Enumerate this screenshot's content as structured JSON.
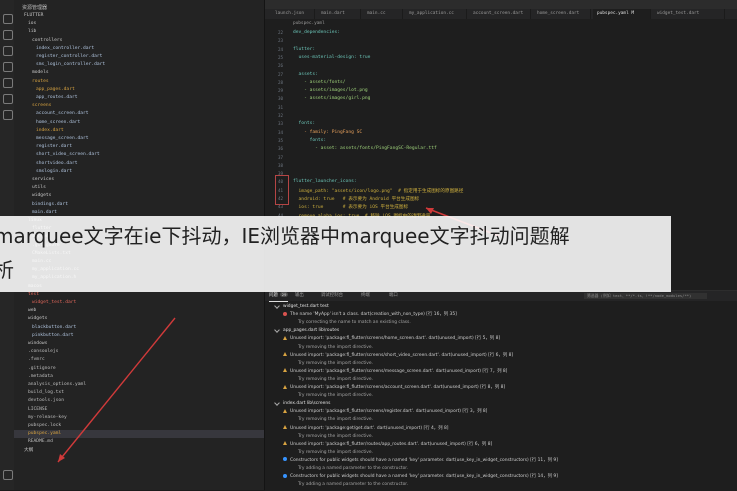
{
  "sidebar": {
    "title": "资源管理器",
    "items": [
      {
        "label": "FLUTTER",
        "kind": "folder"
      },
      {
        "label": "ios",
        "kind": "folder"
      },
      {
        "label": "lib",
        "kind": "folder"
      },
      {
        "label": "controllers",
        "kind": "folder"
      },
      {
        "label": "index_controller.dart",
        "kind": "dart"
      },
      {
        "label": "register_controller.dart",
        "kind": "dart"
      },
      {
        "label": "sms_login_controller.dart",
        "kind": "dart"
      },
      {
        "label": "models",
        "kind": "folder"
      },
      {
        "label": "routes",
        "kind": "warn"
      },
      {
        "label": "app_pages.dart",
        "kind": "warn"
      },
      {
        "label": "app_routes.dart",
        "kind": "dart"
      },
      {
        "label": "screens",
        "kind": "warn"
      },
      {
        "label": "account_screen.dart",
        "kind": "dart"
      },
      {
        "label": "home_screen.dart",
        "kind": "dart"
      },
      {
        "label": "index.dart",
        "kind": "warn"
      },
      {
        "label": "message_screen.dart",
        "kind": "dart"
      },
      {
        "label": "register.dart",
        "kind": "dart"
      },
      {
        "label": "short_video_screen.dart",
        "kind": "dart"
      },
      {
        "label": "shortvideo.dart",
        "kind": "dart"
      },
      {
        "label": "smslogin.dart",
        "kind": "dart"
      },
      {
        "label": "services",
        "kind": "folder"
      },
      {
        "label": "utils",
        "kind": "folder"
      },
      {
        "label": "widgets",
        "kind": "folder"
      },
      {
        "label": "bindings.dart",
        "kind": "dart"
      },
      {
        "label": "main.dart",
        "kind": "dart"
      },
      {
        "label": "linux",
        "kind": "folder"
      },
      {
        "label": "flutter",
        "kind": "folder"
      },
      {
        "label": "screen",
        "kind": "folder"
      },
      {
        "label": ".gitignore",
        "kind": "file"
      },
      {
        "label": "CMakeLists.txt",
        "kind": "file"
      },
      {
        "label": "main.cc",
        "kind": "file"
      },
      {
        "label": "my_application.cc",
        "kind": "file"
      },
      {
        "label": "my_application.h",
        "kind": "file"
      },
      {
        "label": "macos",
        "kind": "folder"
      },
      {
        "label": "test",
        "kind": "err"
      },
      {
        "label": "widget_test.dart",
        "kind": "err"
      },
      {
        "label": "web",
        "kind": "folder"
      },
      {
        "label": "widgets",
        "kind": "folder"
      },
      {
        "label": "blackbutton.dart",
        "kind": "dart"
      },
      {
        "label": "pinkbutton.dart",
        "kind": "dart"
      },
      {
        "label": "windows",
        "kind": "folder"
      },
      {
        "label": ".consoolejs",
        "kind": "file"
      },
      {
        "label": ".fvmrc",
        "kind": "file"
      },
      {
        "label": ".gitignore",
        "kind": "file"
      },
      {
        "label": ".metadata",
        "kind": "file"
      },
      {
        "label": "analysis_options.yaml",
        "kind": "file"
      },
      {
        "label": "build_log.txt",
        "kind": "file"
      },
      {
        "label": "devtools.json",
        "kind": "file"
      },
      {
        "label": "LICENSE",
        "kind": "file"
      },
      {
        "label": "my-release-key",
        "kind": "file"
      },
      {
        "label": "pubspec.lock",
        "kind": "file"
      },
      {
        "label": "pubspec.yaml",
        "kind": "mod"
      },
      {
        "label": "README.md",
        "kind": "file"
      },
      {
        "label": "大纲",
        "kind": "folder"
      }
    ]
  },
  "tabs": [
    {
      "label": "launch.json"
    },
    {
      "label": "main.dart"
    },
    {
      "label": "main.cc"
    },
    {
      "label": "my_application.cc"
    },
    {
      "label": "account_screen.dart"
    },
    {
      "label": "home_screen.dart"
    },
    {
      "label": "pubspec.yaml M"
    },
    {
      "label": "widget_test.dart"
    }
  ],
  "breadcrumb": "pubspec.yaml",
  "code": [
    {
      "n": "22",
      "text": "dev_dependencies:",
      "cls": "c-key"
    },
    {
      "n": "23",
      "text": "",
      "cls": "c-plain"
    },
    {
      "n": "24",
      "text": "flutter:",
      "cls": "c-key"
    },
    {
      "n": "25",
      "text": "  uses-material-design: true",
      "cls": "c-key"
    },
    {
      "n": "26",
      "text": "",
      "cls": "c-plain"
    },
    {
      "n": "27",
      "text": "  assets:",
      "cls": "c-key"
    },
    {
      "n": "28",
      "text": "    - assets/fonts/",
      "cls": "c-str"
    },
    {
      "n": "29",
      "text": "    - assets/images/lot.png",
      "cls": "c-str"
    },
    {
      "n": "30",
      "text": "    - assets/images/girl.png",
      "cls": "c-str"
    },
    {
      "n": "31",
      "text": "",
      "cls": "c-plain"
    },
    {
      "n": "32",
      "text": "",
      "cls": "c-plain"
    },
    {
      "n": "33",
      "text": "  fonts:",
      "cls": "c-key"
    },
    {
      "n": "34",
      "text": "    - family: PingFang SC",
      "cls": "c-val"
    },
    {
      "n": "35",
      "text": "      fonts:",
      "cls": "c-key"
    },
    {
      "n": "36",
      "text": "        - asset: assets/fonts/PingFangSC-Regular.ttf",
      "cls": "c-str"
    },
    {
      "n": "37",
      "text": "",
      "cls": "c-plain"
    },
    {
      "n": "38",
      "text": "",
      "cls": "c-plain"
    },
    {
      "n": "39",
      "text": "",
      "cls": "c-plain"
    },
    {
      "n": "40",
      "text": "flutter_launcher_icons:",
      "cls": "c-key"
    },
    {
      "n": "41",
      "text": "  image_path: \"assets/icon/logo.png\"  # 指定用于生成图标的原图路径",
      "cls": "c-cmt"
    },
    {
      "n": "42",
      "text": "  android: true   # 表示要为 Android 平台生成图标",
      "cls": "c-cmt"
    },
    {
      "n": "43",
      "text": "  ios: true       # 表示要为 iOS 平台生成图标",
      "cls": "c-cmt"
    },
    {
      "n": "44",
      "text": "  remove_alpha_ios: true  # 移除 iOS 图标中的透明通道",
      "cls": "c-cmt"
    }
  ],
  "panel": {
    "tabs": [
      {
        "label": "问题",
        "badge": "29"
      },
      {
        "label": "输出",
        "badge": ""
      },
      {
        "label": "调试控制台",
        "badge": ""
      },
      {
        "label": "终端",
        "badge": ""
      },
      {
        "label": "端口",
        "badge": ""
      }
    ],
    "filter": "筛选器 (例如 text、**/*.ts、!**/node_modules/**)",
    "problems": [
      {
        "type": "file",
        "text": "widget_test.dart  test"
      },
      {
        "type": "err",
        "text": "The name 'MyApp' isn't a class.  dart(creation_with_non_type)  [行 16，列 35]"
      },
      {
        "type": "fix",
        "text": "Try correcting the name to match an existing class."
      },
      {
        "type": "file",
        "text": "app_pages.dart  lib\\routes"
      },
      {
        "type": "warn",
        "text": "Unused import: 'package:fl_flutter/screens/home_screen.dart'.  dart(unused_import)  [行 5，列 8]"
      },
      {
        "type": "fix",
        "text": "Try removing the import directive."
      },
      {
        "type": "warn",
        "text": "Unused import: 'package:fl_flutter/screens/short_video_screen.dart'.  dart(unused_import)  [行 6，列 8]"
      },
      {
        "type": "fix",
        "text": "Try removing the import directive."
      },
      {
        "type": "warn",
        "text": "Unused import: 'package:fl_flutter/screens/message_screen.dart'.  dart(unused_import)  [行 7，列 8]"
      },
      {
        "type": "fix",
        "text": "Try removing the import directive."
      },
      {
        "type": "warn",
        "text": "Unused import: 'package:fl_flutter/screens/account_screen.dart'.  dart(unused_import)  [行 8，列 8]"
      },
      {
        "type": "fix",
        "text": "Try removing the import directive."
      },
      {
        "type": "file",
        "text": "index.dart  lib\\screens"
      },
      {
        "type": "warn",
        "text": "Unused import: 'package:fl_flutter/screens/register.dart'.  dart(unused_import)  [行 3，列 8]"
      },
      {
        "type": "fix",
        "text": "Try removing the import directive."
      },
      {
        "type": "warn",
        "text": "Unused import: 'package:get/get.dart'.  dart(unused_import)  [行 4，列 8]"
      },
      {
        "type": "fix",
        "text": "Try removing the import directive."
      },
      {
        "type": "warn",
        "text": "Unused import: 'package:fl_flutter/routes/app_routes.dart'.  dart(unused_import)  [行 6，列 8]"
      },
      {
        "type": "fix",
        "text": "Try removing the import directive."
      },
      {
        "type": "info",
        "text": "Constructors for public widgets should have a named 'key' parameter.  dart(use_key_in_widget_constructors)  [行 11，列 9]"
      },
      {
        "type": "fix",
        "text": "Try adding a named parameter to the constructor."
      },
      {
        "type": "info",
        "text": "Constructors for public widgets should have a named 'key' parameter.  dart(use_key_in_widget_constructors)  [行 14，列 9]"
      },
      {
        "type": "fix",
        "text": "Try adding a named parameter to the constructor."
      }
    ]
  },
  "overlay": {
    "line1": "marquee文字在ie下抖动，IE浏览器中marquee文字抖动问题解",
    "line2": "析"
  },
  "colors": {
    "arrow": "#d03a3a",
    "overlay": "#ffffff"
  }
}
